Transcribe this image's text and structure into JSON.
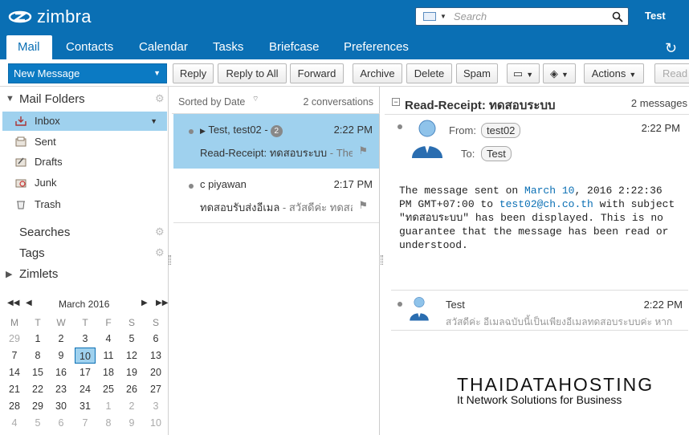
{
  "app": {
    "logo_text": "zimbra",
    "user": "Test"
  },
  "search": {
    "placeholder": "Search"
  },
  "tabs": [
    {
      "label": "Mail"
    },
    {
      "label": "Contacts"
    },
    {
      "label": "Calendar"
    },
    {
      "label": "Tasks"
    },
    {
      "label": "Briefcase"
    },
    {
      "label": "Preferences"
    }
  ],
  "toolbar": {
    "new_message": "New Message",
    "reply": "Reply",
    "reply_all": "Reply to All",
    "forward": "Forward",
    "archive": "Archive",
    "delete": "Delete",
    "spam": "Spam",
    "actions": "Actions",
    "read": "Read"
  },
  "sidebar": {
    "mail_folders": "Mail Folders",
    "folders": [
      {
        "label": "Inbox",
        "icon": "inbox-icon"
      },
      {
        "label": "Sent",
        "icon": "sent-icon"
      },
      {
        "label": "Drafts",
        "icon": "drafts-icon"
      },
      {
        "label": "Junk",
        "icon": "junk-icon"
      },
      {
        "label": "Trash",
        "icon": "trash-icon"
      }
    ],
    "searches": "Searches",
    "tags": "Tags",
    "zimlets": "Zimlets"
  },
  "calendar": {
    "month": "March 2016",
    "weekdays": [
      "M",
      "T",
      "W",
      "T",
      "F",
      "S",
      "S"
    ],
    "weeks": [
      [
        "29",
        "1",
        "2",
        "3",
        "4",
        "5",
        "6"
      ],
      [
        "7",
        "8",
        "9",
        "10",
        "11",
        "12",
        "13"
      ],
      [
        "14",
        "15",
        "16",
        "17",
        "18",
        "19",
        "20"
      ],
      [
        "21",
        "22",
        "23",
        "24",
        "25",
        "26",
        "27"
      ],
      [
        "28",
        "29",
        "30",
        "31",
        "1",
        "2",
        "3"
      ],
      [
        "4",
        "5",
        "6",
        "7",
        "8",
        "9",
        "10"
      ]
    ],
    "today": "10"
  },
  "list": {
    "sort_label": "Sorted by Date",
    "count_label": "2 conversations",
    "items": [
      {
        "from": "Test, test02 -",
        "count": "2",
        "time": "2:22 PM",
        "subject": "Read-Receipt: ทดสอบระบบ",
        "fragment": " - The m"
      },
      {
        "from": "c piyawan",
        "time": "2:17 PM",
        "subject": "ทดสอบรับส่งอีเมล",
        "fragment": " - สวัสดีค่ะ ทดสอ"
      }
    ]
  },
  "reader": {
    "subject": "Read-Receipt: ทดสอบระบบ",
    "count": "2 messages",
    "from_label": "From:",
    "to_label": "To:",
    "from": "test02",
    "to": "Test",
    "time": "2:22 PM",
    "body_1": "The message sent on ",
    "body_link1": "March 10",
    "body_2": ", 2016 2:22:36\nPM GMT+07:00 to ",
    "body_link2": "test02@ch.co.th",
    "body_3": " with subject\n\"ทดสอบระบบ\" has been displayed. This is no\nguarantee that the message has been read or\nunderstood.",
    "second": {
      "from": "Test",
      "time": "2:22 PM",
      "fragment": "สวัสดีค่ะ อีเมลฉบับนี้เป็นเพียงอีเมลทดสอบระบบค่ะ หาก"
    }
  },
  "watermark": {
    "line1": "THAIDATAHOSTING",
    "line2": "It Network Solutions for Business"
  },
  "colors": {
    "brand": "#0a6fb4",
    "selection": "#9fd1ee"
  }
}
